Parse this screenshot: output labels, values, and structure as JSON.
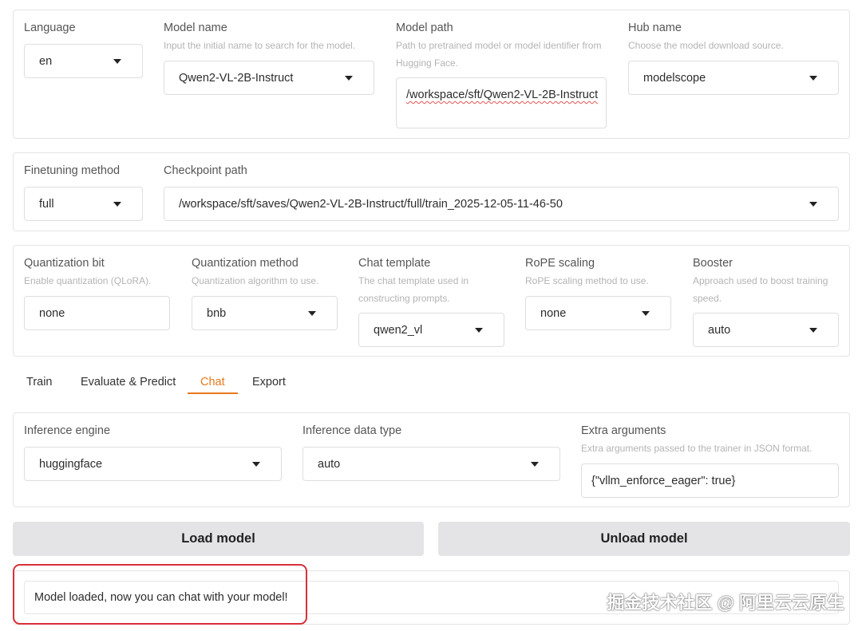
{
  "top_panel": {
    "language": {
      "label": "Language",
      "value": "en"
    },
    "model_name": {
      "label": "Model name",
      "info": "Input the initial name to search for the model.",
      "value": "Qwen2-VL-2B-Instruct"
    },
    "model_path": {
      "label": "Model path",
      "info": "Path to pretrained model or model identifier from Hugging Face.",
      "value": "/workspace/sft/Qwen2-VL-2B-Instruct"
    },
    "hub_name": {
      "label": "Hub name",
      "info": "Choose the model download source.",
      "value": "modelscope"
    }
  },
  "finetune_panel": {
    "finetuning_method": {
      "label": "Finetuning method",
      "value": "full"
    },
    "checkpoint_path": {
      "label": "Checkpoint path",
      "value": "/workspace/sft/saves/Qwen2-VL-2B-Instruct/full/train_2025-12-05-11-46-50"
    }
  },
  "quant_panel": {
    "quantization_bit": {
      "label": "Quantization bit",
      "info": "Enable quantization (QLoRA).",
      "value": "none"
    },
    "quantization_method": {
      "label": "Quantization method",
      "info": "Quantization algorithm to use.",
      "value": "bnb"
    },
    "chat_template": {
      "label": "Chat template",
      "info": "The chat template used in constructing prompts.",
      "value": "qwen2_vl"
    },
    "rope_scaling": {
      "label": "RoPE scaling",
      "info": "RoPE scaling method to use.",
      "value": "none"
    },
    "booster": {
      "label": "Booster",
      "info": "Approach used to boost training speed.",
      "value": "auto"
    }
  },
  "tabs": [
    {
      "label": "Train",
      "active": false
    },
    {
      "label": "Evaluate & Predict",
      "active": false
    },
    {
      "label": "Chat",
      "active": true
    },
    {
      "label": "Export",
      "active": false
    }
  ],
  "inference_panel": {
    "inference_engine": {
      "label": "Inference engine",
      "value": "huggingface"
    },
    "inference_dtype": {
      "label": "Inference data type",
      "value": "auto"
    },
    "extra_arguments": {
      "label": "Extra arguments",
      "info": "Extra arguments passed to the trainer in JSON format.",
      "value": "{\"vllm_enforce_eager\": true}"
    }
  },
  "buttons": {
    "load": "Load model",
    "unload": "Unload model"
  },
  "status": {
    "message": "Model loaded, now you can chat with your model!"
  },
  "watermark": "掘金技术社区 @ 阿里云云原生",
  "colors": {
    "accent": "#e8781a",
    "highlight_border": "#d82f3a",
    "button_bg": "#e4e4e7"
  }
}
